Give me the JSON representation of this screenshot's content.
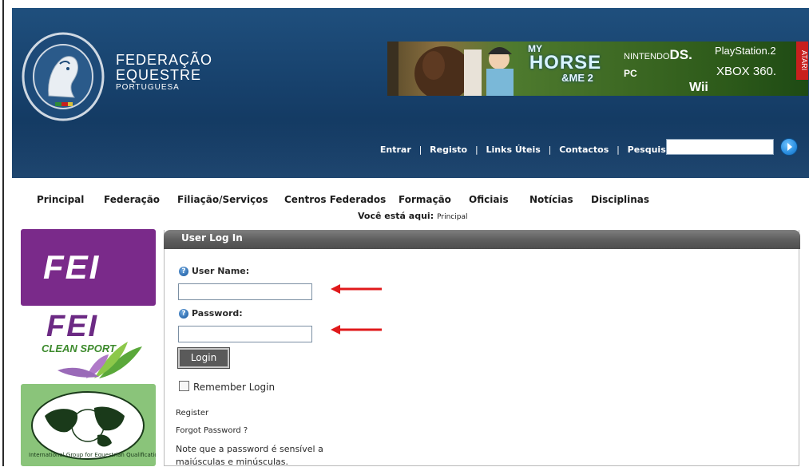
{
  "brand": {
    "line1": "FEDERAÇÃO",
    "line2": "EQUESTRE",
    "line3": "PORTUGUESA",
    "seal_text": "FEDERAÇÃO EQUESTRE PORTUGUESA"
  },
  "banner": {
    "title_my": "MY",
    "title_horse": "HORSE",
    "title_me": "&ME 2",
    "platform_nintendo": "NINTENDO",
    "platform_ds": "DS.",
    "platform_ps2": "PlayStation.2",
    "platform_pc": "PC",
    "platform_x360": "XBOX 360.",
    "platform_wii": "Wii",
    "publisher": "ATARI"
  },
  "toplinks": {
    "items": [
      "Entrar",
      "Registo",
      "Links Úteis",
      "Contactos",
      "Pesquisar:"
    ],
    "separator": "|"
  },
  "search": {
    "value": ""
  },
  "nav": {
    "items": [
      "Principal",
      "Federação",
      "Filiação/Serviços",
      "Centros Federados",
      "Formação",
      "Oficiais",
      "Notícias",
      "Disciplinas"
    ]
  },
  "breadcrumb": {
    "label": "Você está aqui:",
    "value": "Principal"
  },
  "sidebar": {
    "fei_logo": "FEI",
    "clean_logo": "FEI",
    "clean_sport": "CLEAN SPORT",
    "iged_caption": "International Group for Equestrian Qualifications"
  },
  "login": {
    "panel_title": "User Log In",
    "username_label": "User Name:",
    "username_value": "",
    "password_label": "Password:",
    "password_value": "",
    "login_button": "Login",
    "remember_label": "Remember Login",
    "remember_checked": false,
    "register_link": "Register",
    "forgot_link": "Forgot Password ?",
    "note_line1": "Note que a password é sensível a",
    "note_line2": "maiúsculas e minúsculas."
  },
  "annotations": {
    "arrow_color": "#e0191b"
  },
  "colors": {
    "header": "#1a4774",
    "fei_purple": "#7a2a8a",
    "panel_head": "#5f5f5f"
  }
}
